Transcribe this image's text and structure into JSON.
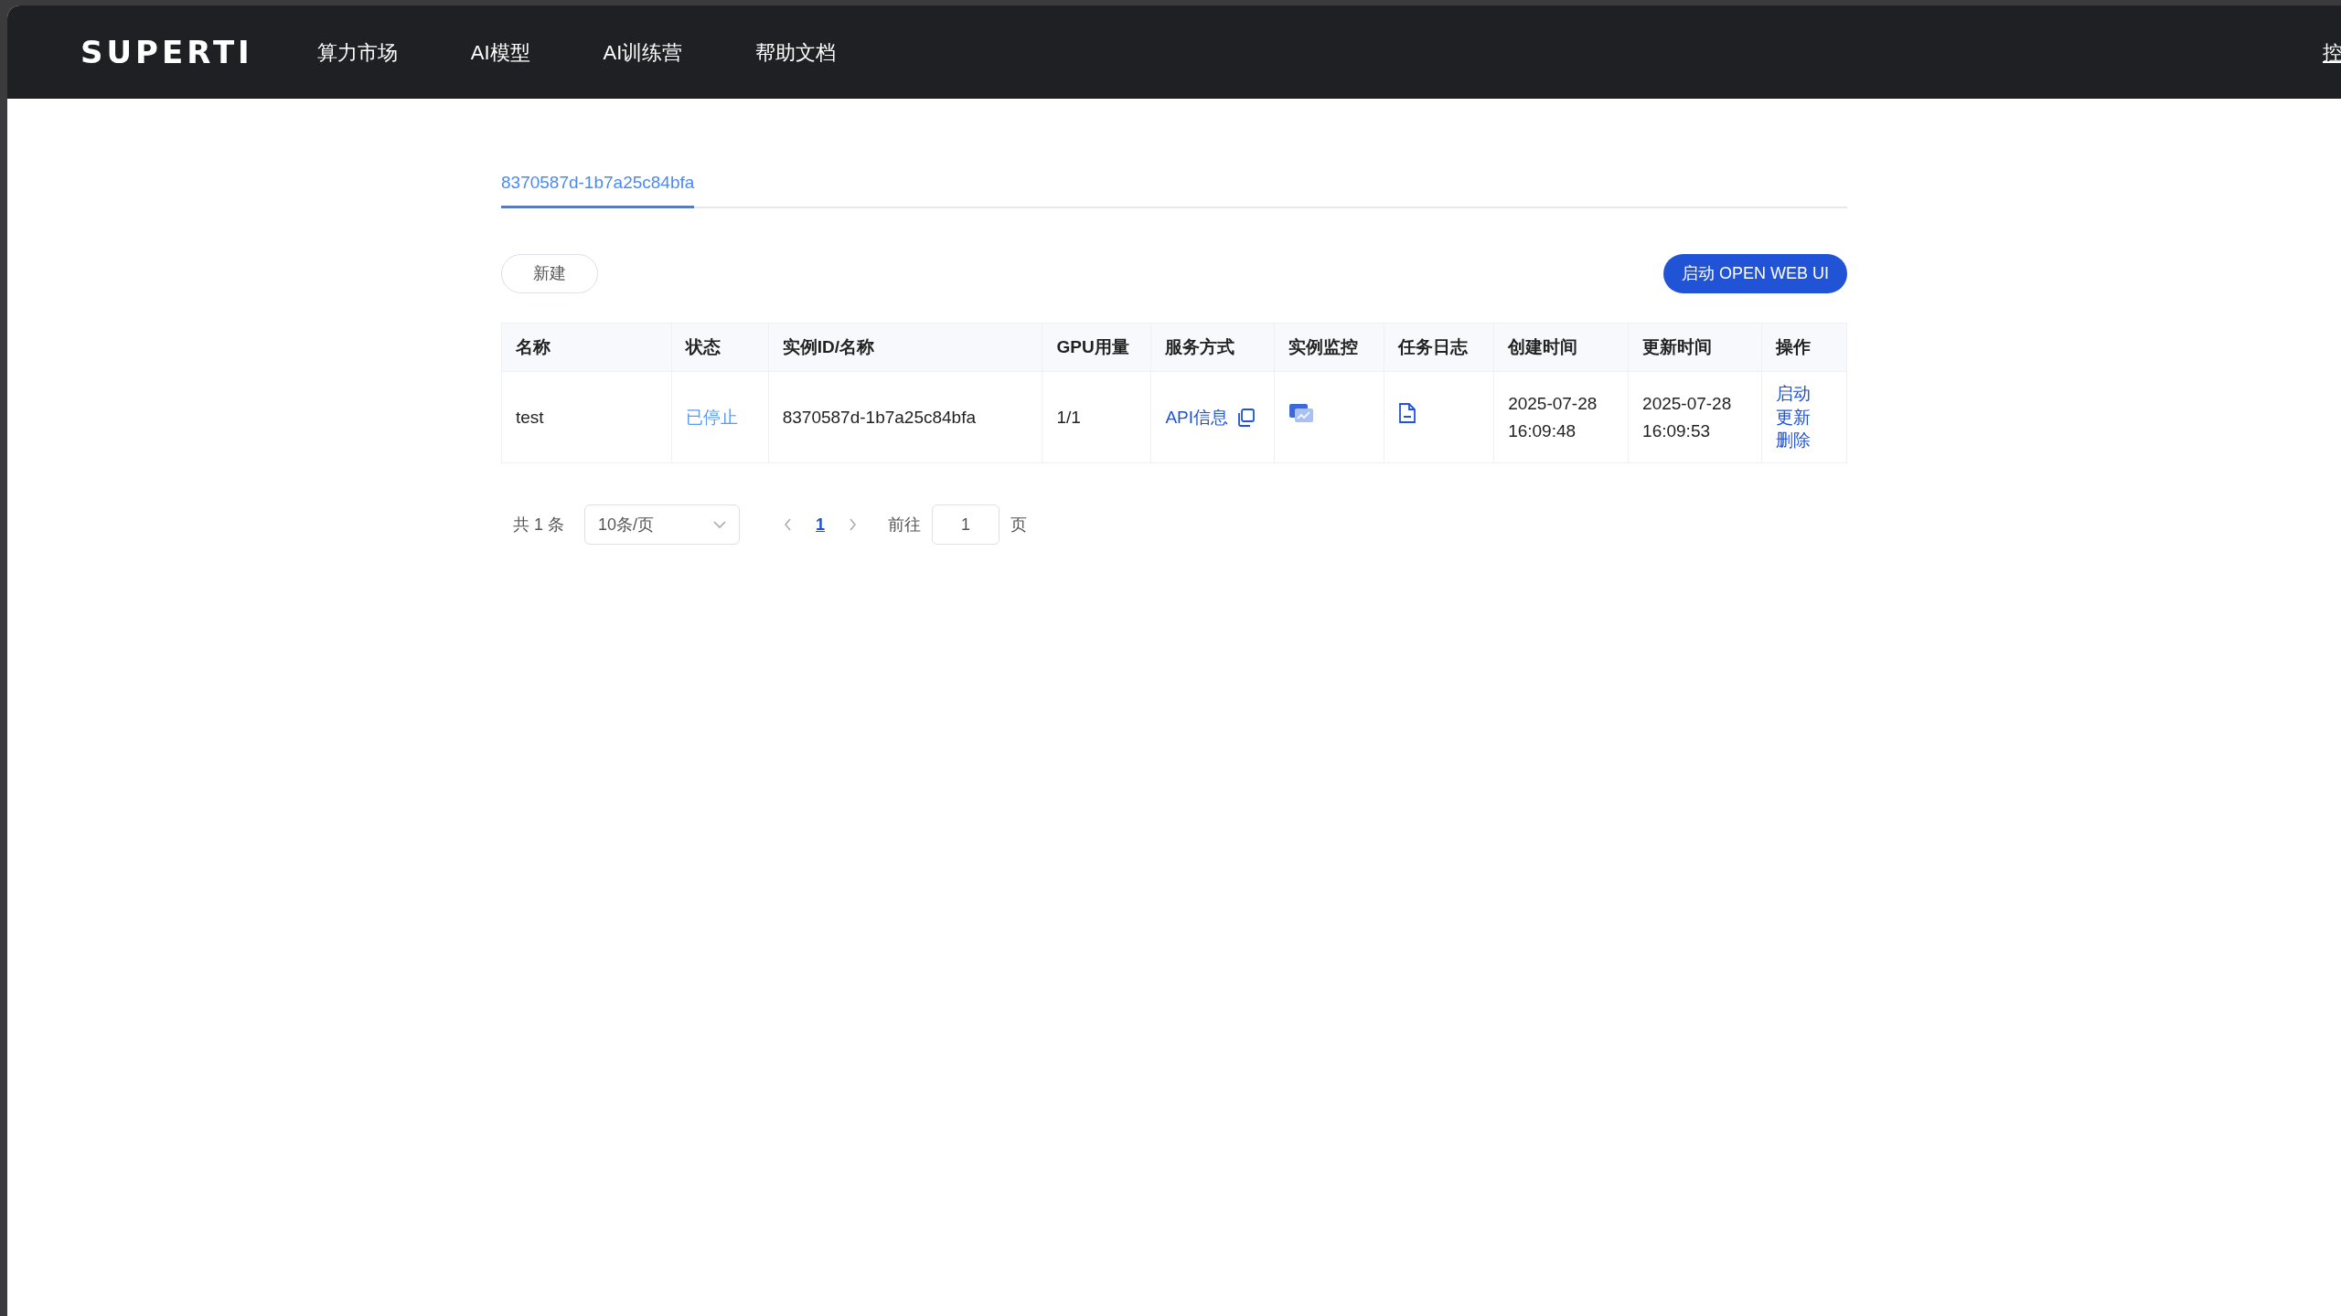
{
  "navbar": {
    "logo": "SUPERTI",
    "items": [
      {
        "label": "算力市场"
      },
      {
        "label": "AI模型"
      },
      {
        "label": "AI训练营"
      },
      {
        "label": "帮助文档"
      }
    ],
    "right_item": "控"
  },
  "tabs": [
    {
      "label": "8370587d-1b7a25c84bfa",
      "selected": true
    }
  ],
  "toolbar": {
    "new_button": "新建",
    "launch_button": "启动 OPEN WEB UI"
  },
  "table": {
    "columns": [
      "名称",
      "状态",
      "实例ID/名称",
      "GPU用量",
      "服务方式",
      "实例监控",
      "任务日志",
      "创建时间",
      "更新时间",
      "操作"
    ],
    "rows": [
      {
        "name": "test",
        "status": {
          "text": "已停止",
          "kind": "stopped"
        },
        "instance_id": "8370587d-1b7a25c84bfa",
        "gpu": "1/1",
        "service": "API信息",
        "created": [
          "2025-07-28",
          "16:09:48"
        ],
        "updated": [
          "2025-07-28",
          "16:09:53"
        ],
        "actions": [
          "启动",
          "更新",
          "删除"
        ]
      }
    ]
  },
  "pagination": {
    "total": "共 1 条",
    "page_size": "10条/页",
    "pages": [
      {
        "label": "1",
        "selected": true
      }
    ],
    "goto_label": "前往",
    "goto_value": "1",
    "goto_suffix": "页"
  }
}
